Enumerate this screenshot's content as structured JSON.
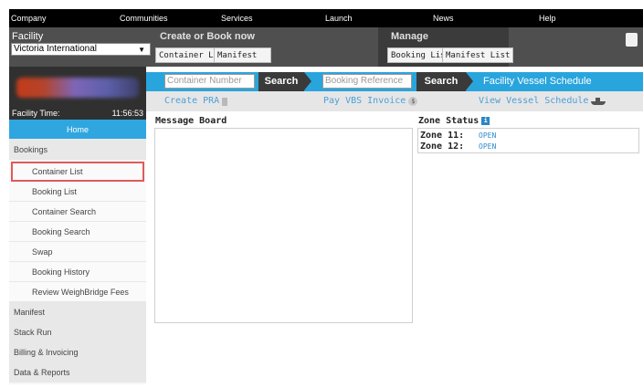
{
  "topnav": {
    "items": [
      "Company",
      "Communities",
      "Services",
      "Launch",
      "News",
      "Help"
    ]
  },
  "header": {
    "facility_label": "Facility",
    "facility_value": "Victoria International",
    "create_label": "Create or Book now",
    "create_buttons": [
      "Container List",
      "Manifest"
    ],
    "manage_label": "Manage",
    "manage_buttons": [
      "Booking List",
      "Manifest List"
    ]
  },
  "facility_time": {
    "label": "Facility Time:",
    "value": "11:56:53"
  },
  "search": {
    "container_placeholder": "Container Number",
    "container_button": "Search",
    "booking_placeholder": "Booking Reference",
    "booking_button": "Search",
    "vessel_schedule_label": "Facility Vessel Schedule"
  },
  "band2": {
    "create_pra": "Create PRA",
    "pay_vbs": "Pay VBS Invoice",
    "view_vessel": "View Vessel Schedule"
  },
  "sidebar": {
    "items": [
      {
        "label": "Home",
        "kind": "home"
      },
      {
        "label": "Bookings",
        "kind": "cat"
      },
      {
        "label": "Container List",
        "kind": "sub-highlight"
      },
      {
        "label": "Booking List",
        "kind": "sub"
      },
      {
        "label": "Container Search",
        "kind": "sub"
      },
      {
        "label": "Booking Search",
        "kind": "sub"
      },
      {
        "label": "Swap",
        "kind": "sub"
      },
      {
        "label": "Booking History",
        "kind": "sub"
      },
      {
        "label": "Review WeighBridge Fees",
        "kind": "sub"
      },
      {
        "label": "Manifest",
        "kind": "cat"
      },
      {
        "label": "Stack Run",
        "kind": "cat"
      },
      {
        "label": "Billing & Invoicing",
        "kind": "cat"
      },
      {
        "label": "Data & Reports",
        "kind": "cat"
      }
    ]
  },
  "message_board": {
    "title": "Message Board"
  },
  "zone_status": {
    "title": "Zone Status",
    "zones": [
      {
        "name": "Zone 11:",
        "status": "OPEN"
      },
      {
        "name": "Zone 12:",
        "status": "OPEN"
      }
    ]
  },
  "colors": {
    "accent_blue": "#29a5dd",
    "header_dark": "#4f4f4f",
    "highlight_red": "#e05a5a",
    "status_open": "#2d8ac9"
  }
}
